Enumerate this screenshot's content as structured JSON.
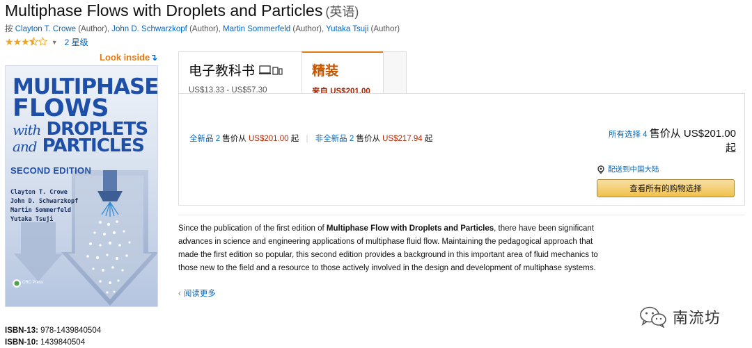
{
  "product": {
    "title": "Multiphase Flows with Droplets and Particles",
    "language": "(英语)",
    "byline_prefix": "按",
    "authors": [
      {
        "name": "Clayton T. Crowe",
        "role": "(Author)",
        "sep": ","
      },
      {
        "name": "John D. Schwarzkopf",
        "role": "(Author)",
        "sep": ","
      },
      {
        "name": "Martin Sommerfeld",
        "role": "(Author)",
        "sep": ","
      },
      {
        "name": "Yutaka Tsuji",
        "role": "(Author)",
        "sep": ""
      }
    ],
    "rating": 3.5,
    "ratings_count_label": "2 星级"
  },
  "look_inside": {
    "label": "Look inside",
    "arrow": "↴"
  },
  "cover": {
    "title_lines": [
      "MULTIPHASE",
      "FLOWS",
      "with",
      "DROPLETS",
      "and",
      "PARTICLES"
    ],
    "edition": "SECOND EDITION",
    "authors": [
      "Clayton T. Crowe",
      "John D. Schwarzkopf",
      "Martin Sommerfeld",
      "Yutaka Tsuji"
    ],
    "publisher": "CRC Press"
  },
  "isbn": [
    {
      "label": "ISBN-13:",
      "value": "978-1439840504"
    },
    {
      "label": "ISBN-10:",
      "value": "1439840504"
    }
  ],
  "formats": {
    "ebook": {
      "label": "电子教科书",
      "price": "US$13.33 - US$57.30"
    },
    "hardcover": {
      "label": "精装",
      "price": "来自 US$201.00"
    }
  },
  "offers": {
    "new_link": "全新品 2",
    "new_from": "售价从",
    "new_price": "US$201.00",
    "new_suffix": "起",
    "used_link": "非全新品 2",
    "used_from": "售价从",
    "used_price": "US$217.94",
    "used_suffix": "起",
    "separator": "|"
  },
  "buybox": {
    "all_options_link": "所有选择 4",
    "all_options_text": "售价从 US$201.00",
    "all_options_suffix": "起",
    "deliver_to": "配送到中国大陆",
    "see_all_button": "查看所有的购物选择"
  },
  "description": {
    "lead": "Since the publication of the first edition of ",
    "bold": "Multiphase Flow with Droplets and Particles",
    "rest": ", there have been significant advances in science and engineering applications of multiphase fluid flow. Maintaining the pedagogical approach that made the first edition so popular, this second edition provides a background in this important area of fluid mechanics to those new to the field and a resource to those actively involved in the design and development of multiphase systems.",
    "read_more": "阅读更多",
    "read_more_chevron": "‹"
  },
  "watermark": {
    "text": "南流坊"
  },
  "colors": {
    "link": "#0066c0",
    "price": "#b12704",
    "accent": "#e47911",
    "star": "#f0a41c",
    "cover_blue": "#1d4fa8"
  }
}
